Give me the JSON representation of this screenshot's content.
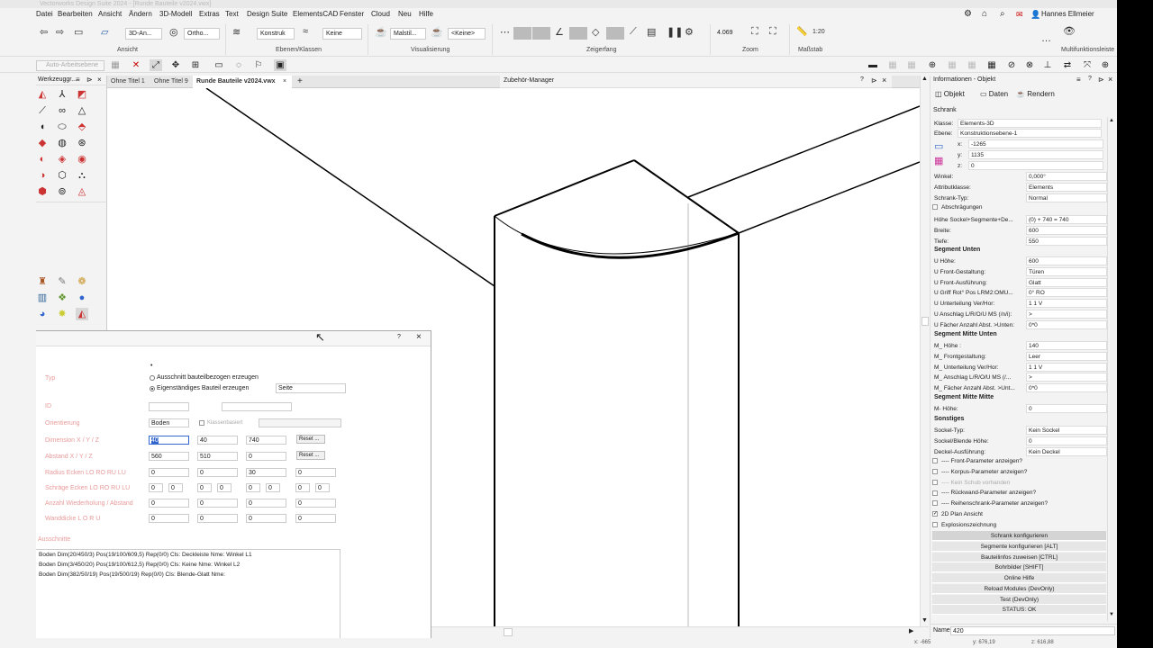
{
  "app": {
    "title": "Vectorworks Design Suite 2024 - [Runde Bauteile v2024.vwx]",
    "user_name": "Hannes Ellmeier"
  },
  "menu": [
    "Datei",
    "Bearbeiten",
    "Ansicht",
    "Ändern",
    "3D-Modell",
    "Extras",
    "Text",
    "Design Suite",
    "ElementsCAD",
    "Fenster",
    "Cloud",
    "Neu",
    "Hilfe"
  ],
  "ribbon": {
    "groups": [
      "Ansicht",
      "Ebenen/Klassen",
      "Visualisierung",
      "Zeigerfang",
      "Zoom",
      "Maßstab",
      "Multifunktionsleiste"
    ],
    "view_dropdown": "3D-An...",
    "projection_dropdown": "Ortho...",
    "class_dropdown": "Konstruk",
    "layer_dropdown": "Keine",
    "render_dropdown": "Malstil...",
    "render_option_dropdown": "<Keine>",
    "zoom_value": "4.069",
    "scale_value": "1:20",
    "workplane": "Auto-Arbeitsebene"
  },
  "palette": {
    "title": "Werkzeuggr..."
  },
  "tabs": [
    "Ohne Titel 1",
    "Ohne Titel 9",
    "Runde Bauteile v2024.vwx"
  ],
  "add_tab": "+",
  "zubehor": {
    "title": "Zubehör-Manager"
  },
  "dialog": {
    "help": "?",
    "close": "×",
    "labels": {
      "typ": "Typ",
      "id": "ID",
      "orientation": "Orientierung",
      "dimension": "Dimension X / Y / Z",
      "abstand": "Abstand X / Y / Z",
      "radius": "Radius Ecken LO RO RU LU",
      "schraege": "Schräge Ecken LO RO RU LU",
      "wiederholung": "Anzahl Wiederholung / Abstand",
      "wanddicke": "Wanddicke L O R U",
      "ausschnitte": "Ausschnitte"
    },
    "radio1": "Ausschnitt bauteilbezogen erzeugen",
    "radio2": "Eigenständiges Bauteil erzeugen",
    "seite": "Seite",
    "orientation_value": "Boden",
    "klassenbasiert": "Klassenbasiert",
    "dim": [
      "40",
      "40",
      "740"
    ],
    "abstand": [
      "560",
      "510",
      "0"
    ],
    "radius": [
      "0",
      "0",
      "30",
      "0"
    ],
    "schraege": [
      "0",
      "0",
      "0",
      "0",
      "0",
      "0",
      "0",
      "0"
    ],
    "wiederholung": [
      "0",
      "0",
      "0",
      "0"
    ],
    "wanddicke": [
      "0",
      "0",
      "0",
      "0"
    ],
    "reset": "Reset ...",
    "list": [
      "Boden Dim(20/450/3) Pos(19/100/609,5) Rep(0/0) Cls: Deckleiste Nme: Winkel L1",
      "Boden Dim(3/450/20) Pos(19/100/612,5) Rep(0/0) Cls: Keine Nme: Winkel L2",
      "Boden Dim(382/50/19) Pos(19/500/19) Rep(0/0) Cls: Blende-Glatt Nme:"
    ]
  },
  "info": {
    "title": "Informationen - Objekt",
    "tabs": [
      "Objekt",
      "Daten",
      "Rendern"
    ],
    "object_type": "Schrank",
    "klasse": "Elements-3D",
    "ebene": "Konstruktionsebene-1",
    "x": "-1265",
    "y": "1135",
    "z": "0",
    "rows1": [
      {
        "k": "Winkel:",
        "v": "0,000°"
      },
      {
        "k": "Attributklasse:",
        "v": "Elements"
      },
      {
        "k": "Schrank-Typ:",
        "v": "Normal"
      }
    ],
    "abschraegungen": "Abschrägungen",
    "rows2": [
      {
        "k": "Höhe Sockel+Segmente+De...",
        "v": "(0) + 740 = 740"
      },
      {
        "k": "Breite:",
        "v": "600"
      },
      {
        "k": "Tiefe:",
        "v": "550"
      }
    ],
    "seg_unten": "Segment Unten",
    "rows3": [
      {
        "k": "U Höhe:",
        "v": "600"
      },
      {
        "k": "U Front-Gestaltung:",
        "v": "Türen"
      },
      {
        "k": "U Front-Ausführung:",
        "v": "Glatt"
      },
      {
        "k": "U Griff Rot° Pos LRM2:OMU...",
        "v": "0° RO"
      },
      {
        "k": "U Unterteilung Ver/Hor:",
        "v": "1 1 V"
      },
      {
        "k": "U Anschlag L/R/O/U  MS (/n/i):",
        "v": ">"
      },
      {
        "k": "U Fächer Anzahl Abst. >Unten:",
        "v": "0*0"
      }
    ],
    "seg_mitte_unten": "Segment Mitte Unten",
    "rows4": [
      {
        "k": "M_ Höhe :",
        "v": "140"
      },
      {
        "k": "M_ Frontgestaltung:",
        "v": "Leer"
      },
      {
        "k": "M_ Unterteilung Ver/Hor:",
        "v": "1 1 V"
      },
      {
        "k": "M_ Anschlag L/R/O/U  MS (/...",
        "v": ">"
      },
      {
        "k": "M_ Fächer Anzahl Abst. >Unt...",
        "v": "0*0"
      }
    ],
    "seg_mitte_mitte": "Segment Mitte Mitte",
    "rows5": [
      {
        "k": "M- Höhe:",
        "v": "0"
      }
    ],
    "sonstiges": "Sonstiges",
    "rows6": [
      {
        "k": "Sockel-Typ:",
        "v": "Kein Sockel"
      },
      {
        "k": "Sockel/Blende Höhe:",
        "v": "0"
      },
      {
        "k": "Deckel-Ausführung:",
        "v": "Kein Deckel"
      }
    ],
    "checks": [
      {
        "label": "---- Front-Parameter anzeigen?",
        "checked": false
      },
      {
        "label": "---- Korpus-Parameter anzeigen?",
        "checked": false
      },
      {
        "label": "---- Kein Schub vorhanden",
        "checked": false
      },
      {
        "label": "---- Rückwand-Parameter anzeigen?",
        "checked": false
      },
      {
        "label": "---- Reihenschrank-Parameter anzeigen?",
        "checked": false
      },
      {
        "label": "2D Plan Ansicht",
        "checked": true
      },
      {
        "label": "Explosionszeichnung",
        "checked": false
      }
    ],
    "buttons": [
      "Schrank konfigurieren",
      "Segmente konfigurieren  [ALT]",
      "Bauteilinfos zuweisen  [CTRL]",
      "Bohrbilder  [SHIFT]",
      "Online Hilfe",
      "Reload Modules (DevOnly)",
      "Test (DevOnly)",
      "STATUS: OK"
    ],
    "name_label": "Name",
    "name_value": "420"
  },
  "status": {
    "x": "x: -665",
    "y": "y: 676,19",
    "z": "z: 616,88"
  }
}
